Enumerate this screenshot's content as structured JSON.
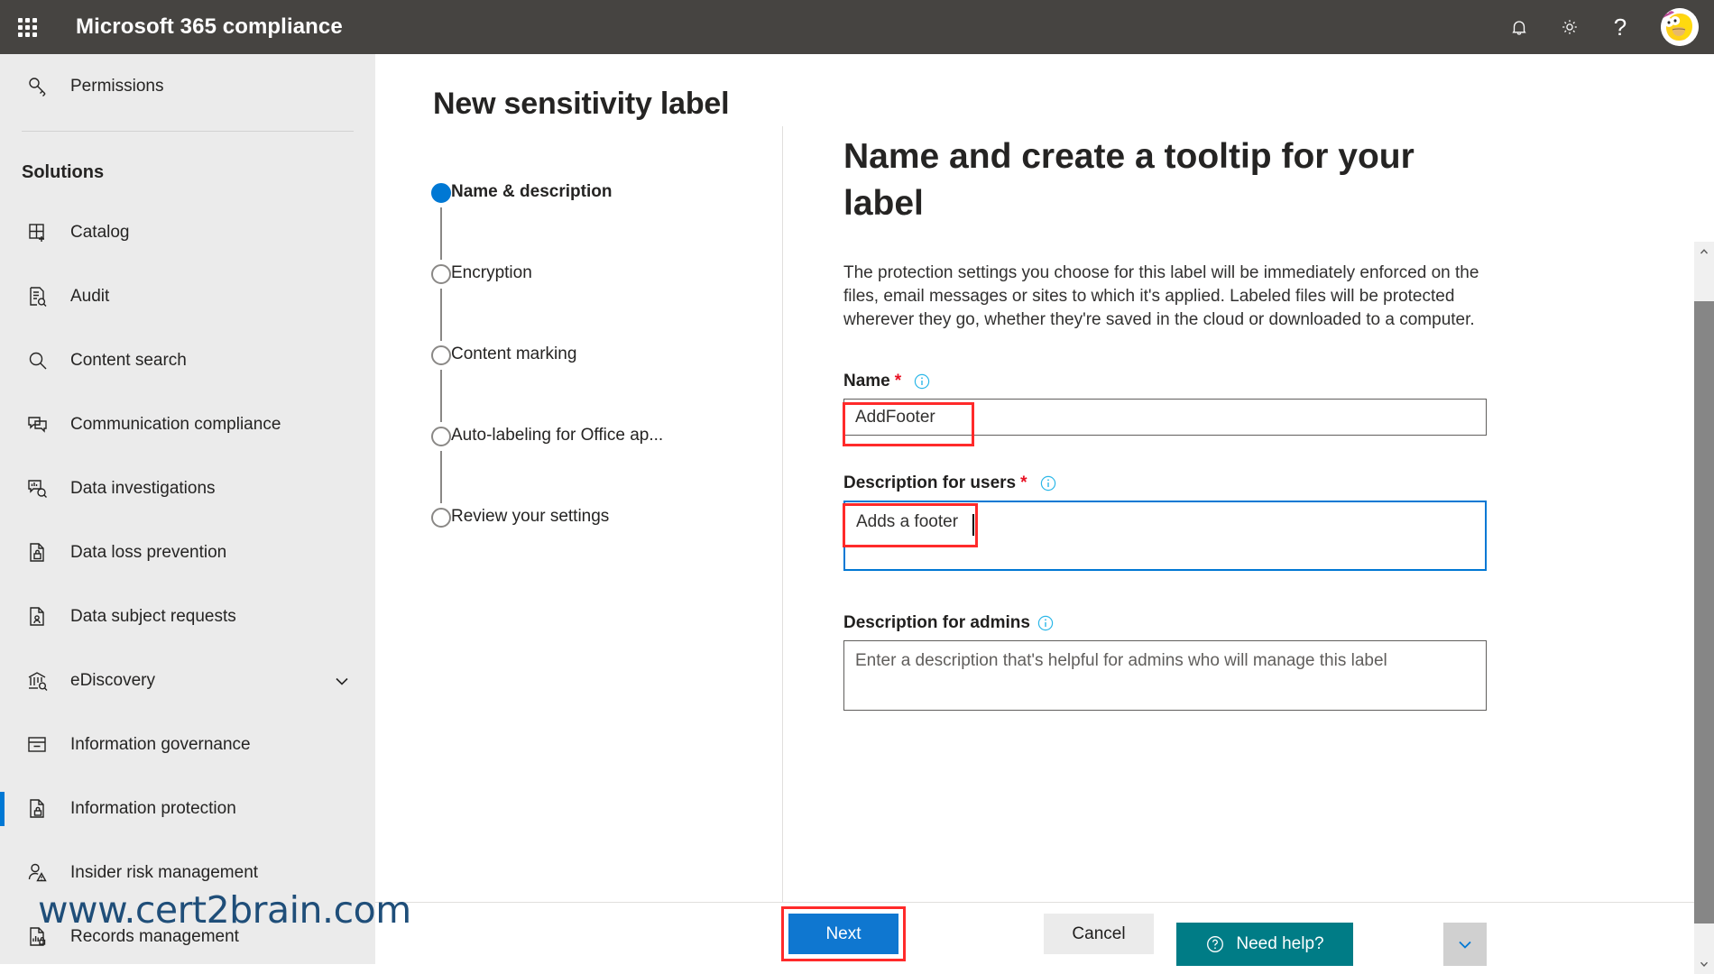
{
  "suite": {
    "title": "Microsoft 365 compliance",
    "waffle_icon": "app-launcher-waffle-icon",
    "notifications_icon": "bell-icon",
    "settings_icon": "gear-icon",
    "help_glyph": "?",
    "avatar_icon": "user-avatar"
  },
  "sidebar": {
    "top_items": [
      {
        "label": "Permissions",
        "icon": "key-icon"
      }
    ],
    "section_title": "Solutions",
    "items": [
      {
        "label": "Catalog",
        "icon": "catalog-grid-plus-icon",
        "selected": false,
        "expandable": false
      },
      {
        "label": "Audit",
        "icon": "audit-document-search-icon",
        "selected": false,
        "expandable": false
      },
      {
        "label": "Content search",
        "icon": "search-magnifier-icon",
        "selected": false,
        "expandable": false
      },
      {
        "label": "Communication compliance",
        "icon": "chat-bubbles-icon",
        "selected": false,
        "expandable": false
      },
      {
        "label": "Data investigations",
        "icon": "data-investigations-icon",
        "selected": false,
        "expandable": false
      },
      {
        "label": "Data loss prevention",
        "icon": "document-lock-icon",
        "selected": false,
        "expandable": false
      },
      {
        "label": "Data subject requests",
        "icon": "document-person-icon",
        "selected": false,
        "expandable": false
      },
      {
        "label": "eDiscovery",
        "icon": "bank-search-icon",
        "selected": false,
        "expandable": true
      },
      {
        "label": "Information governance",
        "icon": "archive-box-icon",
        "selected": false,
        "expandable": false
      },
      {
        "label": "Information protection",
        "icon": "document-shield-lock-icon",
        "selected": true,
        "expandable": false
      },
      {
        "label": "Insider risk management",
        "icon": "person-warning-icon",
        "selected": false,
        "expandable": false
      },
      {
        "label": "Records management",
        "icon": "records-chart-lock-icon",
        "selected": false,
        "expandable": false
      }
    ]
  },
  "watermark": "www.cert2brain.com",
  "page": {
    "title": "New sensitivity label"
  },
  "wizard": {
    "steps": [
      {
        "label": "Name & description",
        "state": "active"
      },
      {
        "label": "Encryption",
        "state": "pending"
      },
      {
        "label": "Content marking",
        "state": "pending"
      },
      {
        "label": "Auto-labeling for Office ap...",
        "state": "pending"
      },
      {
        "label": "Review your settings",
        "state": "pending"
      }
    ]
  },
  "content": {
    "heading": "Name and create a tooltip for your label",
    "description": "The protection settings you choose for this label will be immediately enforced on the files, email messages or sites to which it's applied. Labeled files will be protected wherever they go, whether they're saved in the cloud or downloaded to a computer.",
    "fields": {
      "name": {
        "label": "Name",
        "required_marker": "*",
        "info_icon": "info-circle-icon",
        "value": "AddFooter",
        "placeholder": ""
      },
      "description_users": {
        "label": "Description for users",
        "required_marker": "*",
        "info_icon": "info-circle-icon",
        "value": "Adds a footer",
        "placeholder": "",
        "focused": true
      },
      "description_admins": {
        "label": "Description for admins",
        "required_marker": "",
        "info_icon": "info-circle-icon",
        "value": "",
        "placeholder": "Enter a description that's helpful for admins who will manage this label"
      }
    }
  },
  "footer": {
    "next_label": "Next",
    "cancel_label": "Cancel",
    "need_help_label": "Need help?",
    "need_help_icon": "question-circle-icon",
    "collapse_icon": "chevron-down-icon"
  },
  "scrollbar": {
    "up_icon": "chevron-up-icon",
    "down_icon": "chevron-down-icon"
  },
  "colors": {
    "suite_bar": "#464441",
    "accent_blue": "#0078d4",
    "teal": "#007c86",
    "required_red": "#e81123",
    "annotation_red": "#ff2a2a",
    "sidebar_bg": "#ebebeb",
    "watermark_blue": "#1f4e79"
  }
}
